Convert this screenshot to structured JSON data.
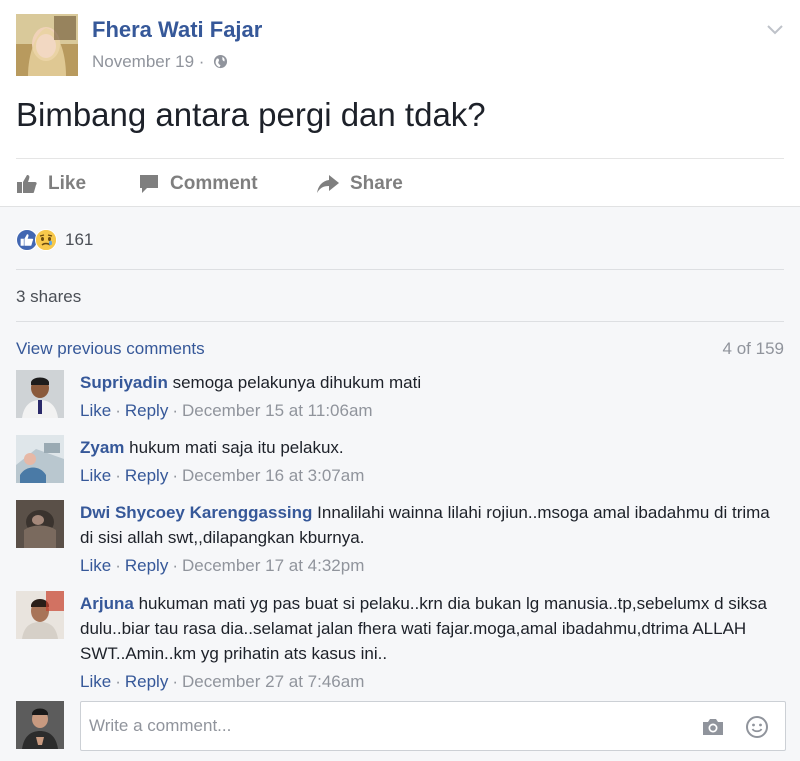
{
  "post": {
    "author": "Fhera Wati Fajar",
    "date": "November 19",
    "separator": "·",
    "text": "Bimbang antara pergi dan tdak?"
  },
  "icons": {
    "author_avatar": "author-avatar",
    "privacy": "globe-icon",
    "options": "chevron-down-icon",
    "like": "thumbs-up-icon",
    "comment": "comment-bubble-icon",
    "share": "share-arrow-icon",
    "reaction_like": "like-reaction-icon",
    "reaction_sad": "sad-reaction-icon",
    "camera": "camera-icon",
    "emoji": "smiley-icon"
  },
  "actions": {
    "like": "Like",
    "comment": "Comment",
    "share": "Share"
  },
  "reactions": {
    "count": "161"
  },
  "shares": "3 shares",
  "comments_header": {
    "view_previous": "View previous comments",
    "count": "4 of 159"
  },
  "comments": [
    {
      "name": "Supriyadin",
      "text": "semoga pelakunya dihukum mati",
      "like": "Like",
      "reply": "Reply",
      "time": "December 15 at 11:06am"
    },
    {
      "name": "Zyam",
      "text": "hukum mati saja itu pelakux.",
      "like": "Like",
      "reply": "Reply",
      "time": "December 16 at 3:07am"
    },
    {
      "name": "Dwi Shycoey Karenggassing",
      "text": "Innalilahi wainna lilahi rojiun..msoga amal ibadahmu di trima di sisi allah swt,,dilapangkan kburnya.",
      "like": "Like",
      "reply": "Reply",
      "time": "December 17 at 4:32pm"
    },
    {
      "name": "Arjuna",
      "text": "hukuman mati yg pas buat si pelaku..krn dia bukan lg manusia..tp,sebelumx d siksa dulu..biar tau rasa dia..selamat jalan fhera wati fajar.moga,amal ibadahmu,dtrima ALLAH SWT..Amin..km yg prihatin ats kasus ini..",
      "like": "Like",
      "reply": "Reply",
      "time": "December 27 at 7:46am"
    }
  ],
  "write_comment": {
    "placeholder": "Write a comment..."
  },
  "colors": {
    "link": "#365899",
    "meta": "#90949c",
    "action": "#7f7f7f",
    "comments_bg": "#f6f7f9",
    "like_blue": "#4267b2",
    "sad_yellow": "#f7c84b"
  }
}
